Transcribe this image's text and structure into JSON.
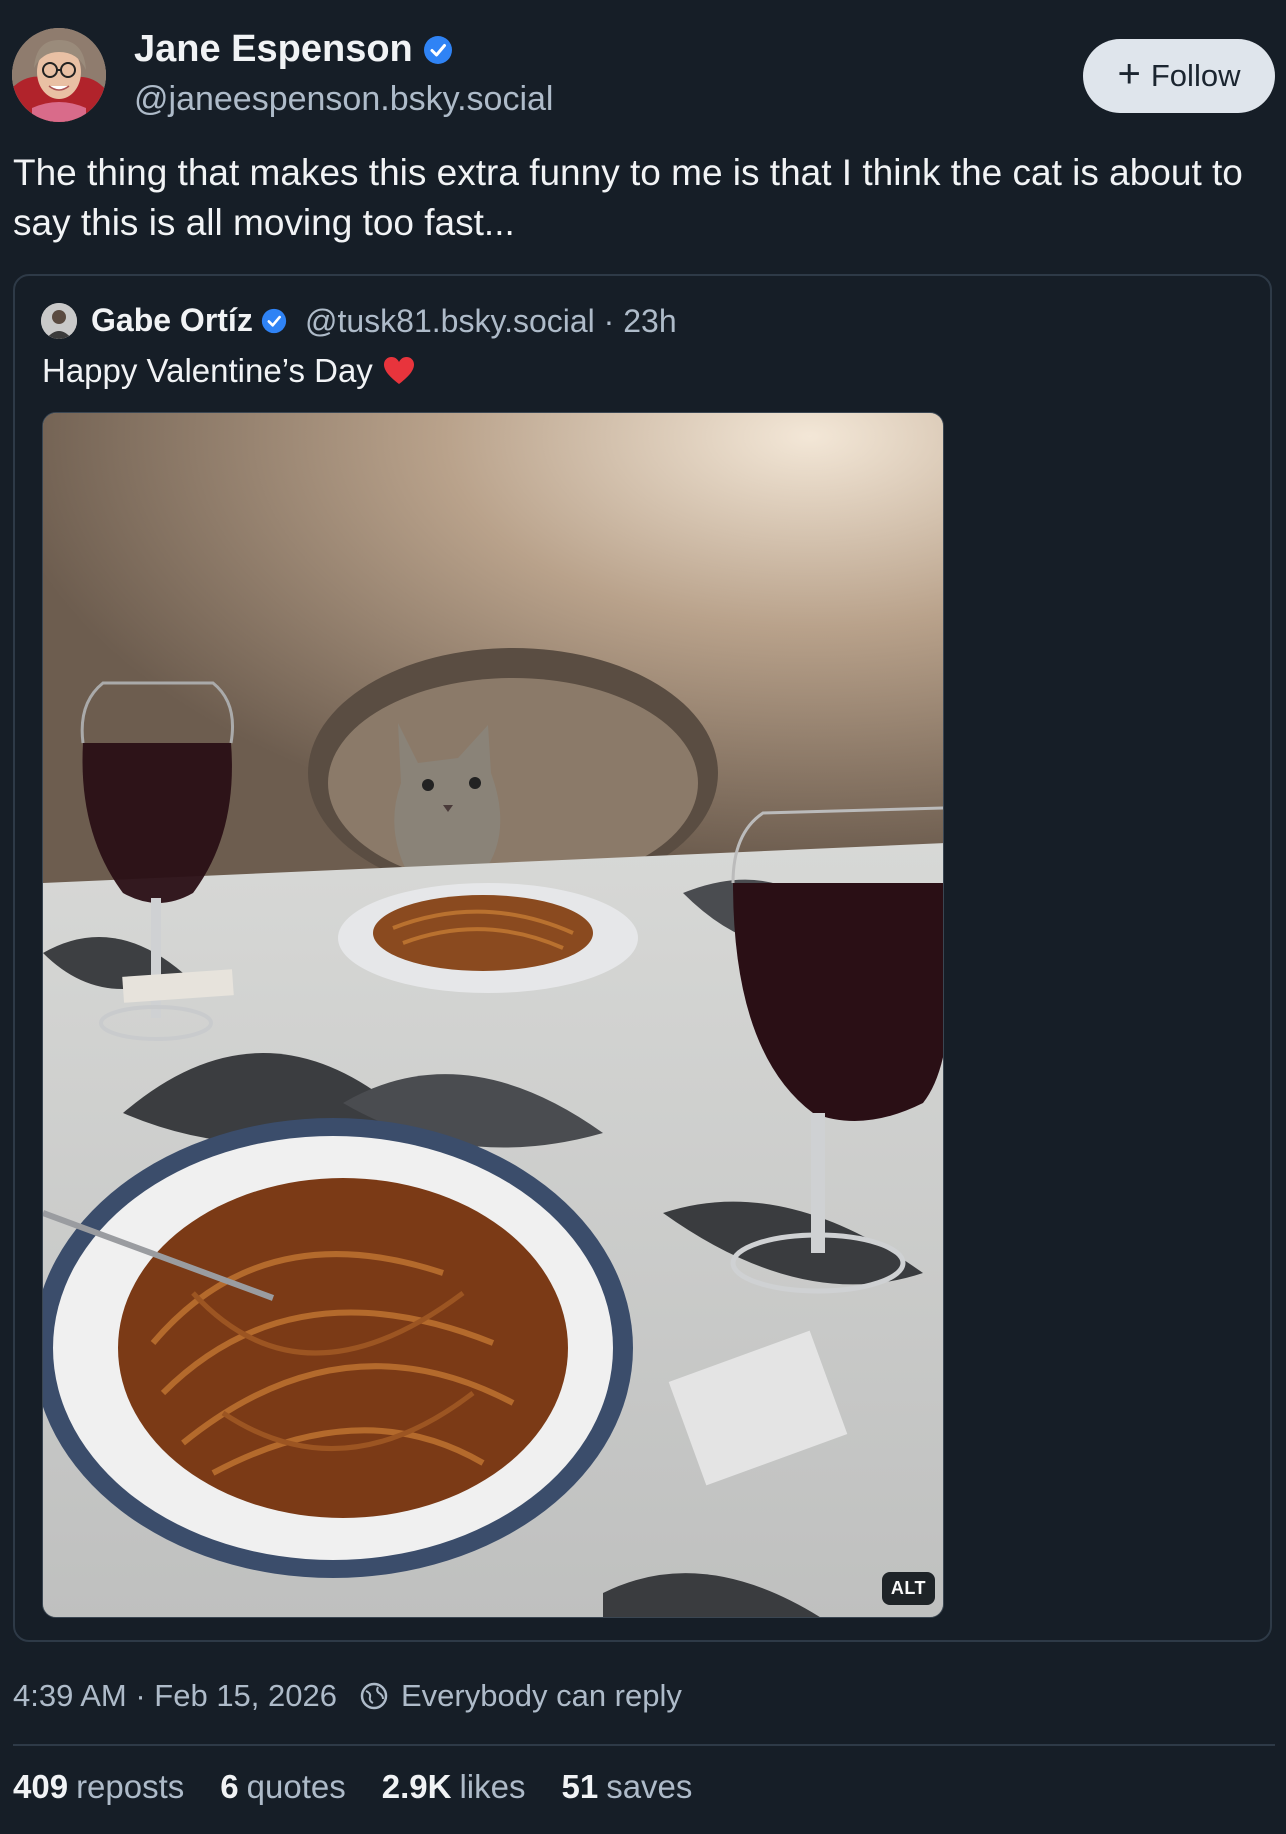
{
  "author": {
    "display_name": "Jane Espenson",
    "handle": "@janeespenson.bsky.social",
    "verified": true
  },
  "follow_label": "Follow",
  "post_text": "The thing that makes this extra funny to me is that I think the cat is about to say this is all moving too fast...",
  "quote": {
    "display_name": "Gabe Ortíz",
    "handle_and_time": "@tusk81.bsky.social · 23h",
    "text": "Happy Valentine’s Day",
    "emoji": "❤️",
    "image_alt_label": "ALT"
  },
  "meta": {
    "timestamp": "4:39 AM · Feb 15, 2026",
    "reply_setting": "Everybody can reply"
  },
  "stats": [
    {
      "count": "409",
      "label": "reposts"
    },
    {
      "count": "6",
      "label": "quotes"
    },
    {
      "count": "2.9K",
      "label": "likes"
    },
    {
      "count": "51",
      "label": "saves"
    }
  ],
  "colors": {
    "background": "#161e27",
    "verified_blue": "#2f83f5",
    "follow_button_bg": "#dfe5ec"
  }
}
